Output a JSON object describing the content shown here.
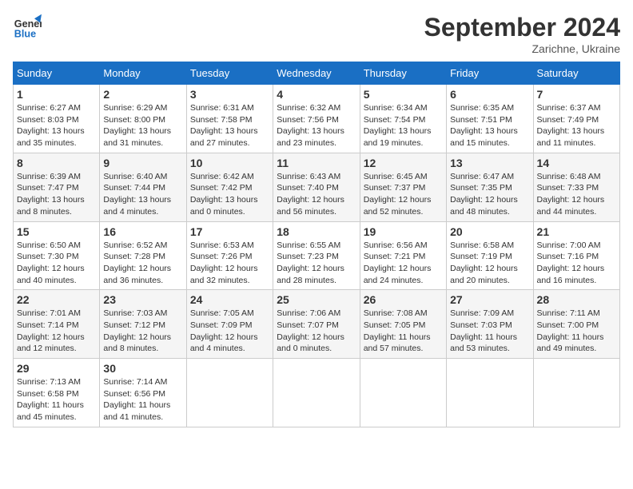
{
  "header": {
    "logo_line1": "General",
    "logo_line2": "Blue",
    "month_title": "September 2024",
    "location": "Zarichne, Ukraine"
  },
  "weekdays": [
    "Sunday",
    "Monday",
    "Tuesday",
    "Wednesday",
    "Thursday",
    "Friday",
    "Saturday"
  ],
  "weeks": [
    [
      {
        "day": "1",
        "sunrise": "6:27 AM",
        "sunset": "8:03 PM",
        "daylight": "13 hours and 35 minutes."
      },
      {
        "day": "2",
        "sunrise": "6:29 AM",
        "sunset": "8:00 PM",
        "daylight": "13 hours and 31 minutes."
      },
      {
        "day": "3",
        "sunrise": "6:31 AM",
        "sunset": "7:58 PM",
        "daylight": "13 hours and 27 minutes."
      },
      {
        "day": "4",
        "sunrise": "6:32 AM",
        "sunset": "7:56 PM",
        "daylight": "13 hours and 23 minutes."
      },
      {
        "day": "5",
        "sunrise": "6:34 AM",
        "sunset": "7:54 PM",
        "daylight": "13 hours and 19 minutes."
      },
      {
        "day": "6",
        "sunrise": "6:35 AM",
        "sunset": "7:51 PM",
        "daylight": "13 hours and 15 minutes."
      },
      {
        "day": "7",
        "sunrise": "6:37 AM",
        "sunset": "7:49 PM",
        "daylight": "13 hours and 11 minutes."
      }
    ],
    [
      {
        "day": "8",
        "sunrise": "6:39 AM",
        "sunset": "7:47 PM",
        "daylight": "13 hours and 8 minutes."
      },
      {
        "day": "9",
        "sunrise": "6:40 AM",
        "sunset": "7:44 PM",
        "daylight": "13 hours and 4 minutes."
      },
      {
        "day": "10",
        "sunrise": "6:42 AM",
        "sunset": "7:42 PM",
        "daylight": "13 hours and 0 minutes."
      },
      {
        "day": "11",
        "sunrise": "6:43 AM",
        "sunset": "7:40 PM",
        "daylight": "12 hours and 56 minutes."
      },
      {
        "day": "12",
        "sunrise": "6:45 AM",
        "sunset": "7:37 PM",
        "daylight": "12 hours and 52 minutes."
      },
      {
        "day": "13",
        "sunrise": "6:47 AM",
        "sunset": "7:35 PM",
        "daylight": "12 hours and 48 minutes."
      },
      {
        "day": "14",
        "sunrise": "6:48 AM",
        "sunset": "7:33 PM",
        "daylight": "12 hours and 44 minutes."
      }
    ],
    [
      {
        "day": "15",
        "sunrise": "6:50 AM",
        "sunset": "7:30 PM",
        "daylight": "12 hours and 40 minutes."
      },
      {
        "day": "16",
        "sunrise": "6:52 AM",
        "sunset": "7:28 PM",
        "daylight": "12 hours and 36 minutes."
      },
      {
        "day": "17",
        "sunrise": "6:53 AM",
        "sunset": "7:26 PM",
        "daylight": "12 hours and 32 minutes."
      },
      {
        "day": "18",
        "sunrise": "6:55 AM",
        "sunset": "7:23 PM",
        "daylight": "12 hours and 28 minutes."
      },
      {
        "day": "19",
        "sunrise": "6:56 AM",
        "sunset": "7:21 PM",
        "daylight": "12 hours and 24 minutes."
      },
      {
        "day": "20",
        "sunrise": "6:58 AM",
        "sunset": "7:19 PM",
        "daylight": "12 hours and 20 minutes."
      },
      {
        "day": "21",
        "sunrise": "7:00 AM",
        "sunset": "7:16 PM",
        "daylight": "12 hours and 16 minutes."
      }
    ],
    [
      {
        "day": "22",
        "sunrise": "7:01 AM",
        "sunset": "7:14 PM",
        "daylight": "12 hours and 12 minutes."
      },
      {
        "day": "23",
        "sunrise": "7:03 AM",
        "sunset": "7:12 PM",
        "daylight": "12 hours and 8 minutes."
      },
      {
        "day": "24",
        "sunrise": "7:05 AM",
        "sunset": "7:09 PM",
        "daylight": "12 hours and 4 minutes."
      },
      {
        "day": "25",
        "sunrise": "7:06 AM",
        "sunset": "7:07 PM",
        "daylight": "12 hours and 0 minutes."
      },
      {
        "day": "26",
        "sunrise": "7:08 AM",
        "sunset": "7:05 PM",
        "daylight": "11 hours and 57 minutes."
      },
      {
        "day": "27",
        "sunrise": "7:09 AM",
        "sunset": "7:03 PM",
        "daylight": "11 hours and 53 minutes."
      },
      {
        "day": "28",
        "sunrise": "7:11 AM",
        "sunset": "7:00 PM",
        "daylight": "11 hours and 49 minutes."
      }
    ],
    [
      {
        "day": "29",
        "sunrise": "7:13 AM",
        "sunset": "6:58 PM",
        "daylight": "11 hours and 45 minutes."
      },
      {
        "day": "30",
        "sunrise": "7:14 AM",
        "sunset": "6:56 PM",
        "daylight": "11 hours and 41 minutes."
      },
      null,
      null,
      null,
      null,
      null
    ]
  ]
}
